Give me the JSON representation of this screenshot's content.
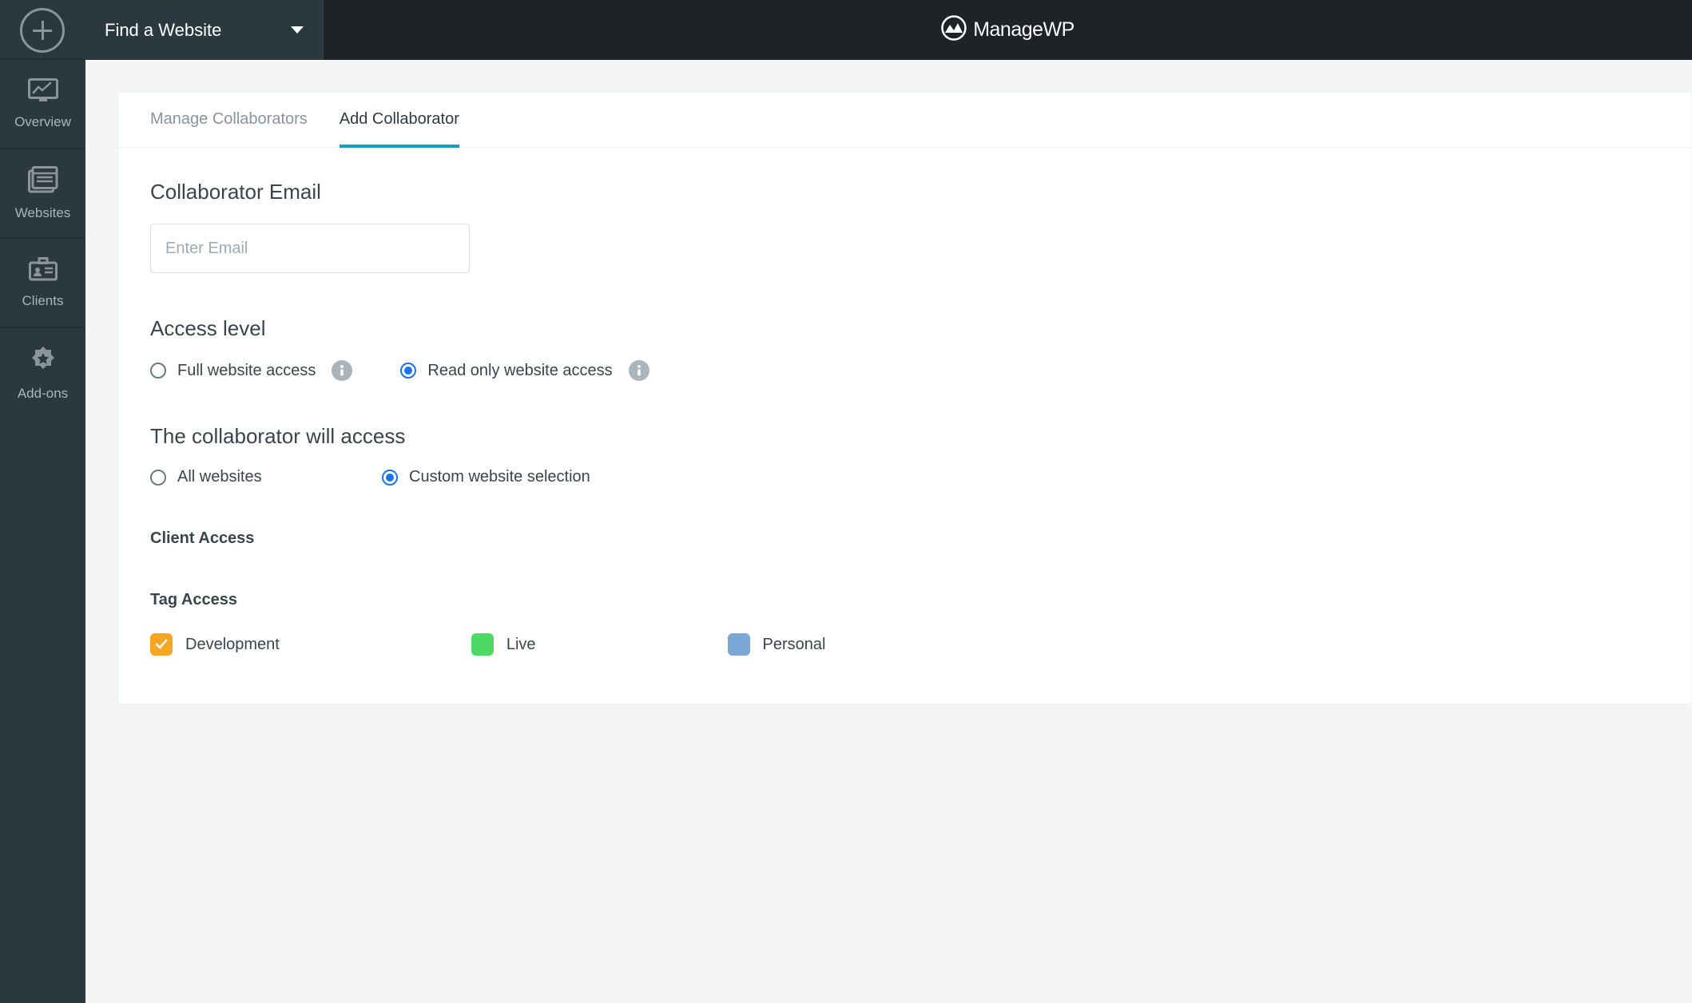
{
  "brand": {
    "name": "ManageWP"
  },
  "topbar": {
    "find_label": "Find a Website"
  },
  "sidebar": {
    "items": [
      {
        "label": "Overview"
      },
      {
        "label": "Websites"
      },
      {
        "label": "Clients"
      },
      {
        "label": "Add-ons"
      }
    ]
  },
  "tabs": {
    "manage": "Manage Collaborators",
    "add": "Add Collaborator"
  },
  "form": {
    "email_heading": "Collaborator Email",
    "email_placeholder": "Enter Email",
    "access_heading": "Access level",
    "access_options": {
      "full": "Full website access",
      "readonly": "Read only website access"
    },
    "scope_heading": "The collaborator will access",
    "scope_options": {
      "all": "All websites",
      "custom": "Custom website selection"
    },
    "client_heading": "Client Access",
    "tag_heading": "Tag Access",
    "tags": {
      "dev": "Development",
      "live": "Live",
      "personal": "Personal"
    }
  }
}
